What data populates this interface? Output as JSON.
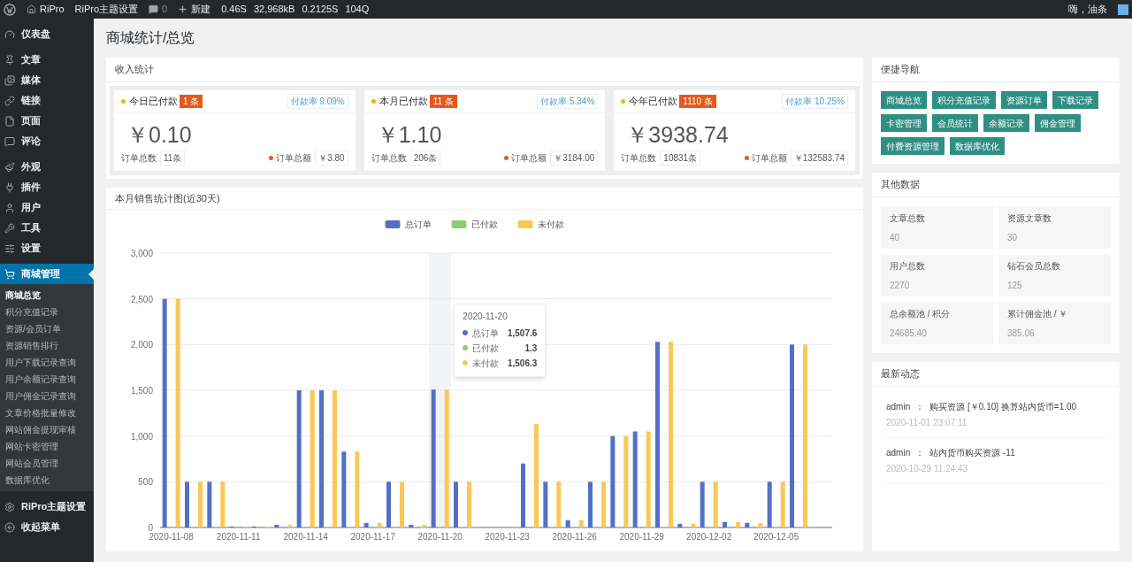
{
  "admin_bar": {
    "site": "RiPro",
    "theme_settings": "RiPro主题设置",
    "comments": "0",
    "new": "新建",
    "stats": [
      "0.46S",
      "32,968kB",
      "0.2125S",
      "104Q"
    ],
    "greeting": "嗨，油条"
  },
  "sidebar": {
    "groups": [
      [
        {
          "label": "仪表盘",
          "selected": false
        }
      ],
      [
        {
          "label": "文章",
          "selected": false
        },
        {
          "label": "媒体",
          "selected": false
        },
        {
          "label": "链接",
          "selected": false
        },
        {
          "label": "页面",
          "selected": false
        },
        {
          "label": "评论",
          "selected": false
        }
      ],
      [
        {
          "label": "外观",
          "selected": false
        },
        {
          "label": "插件",
          "selected": false
        },
        {
          "label": "用户",
          "selected": false
        },
        {
          "label": "工具",
          "selected": false
        },
        {
          "label": "设置",
          "selected": false
        }
      ],
      [
        {
          "label": "商城管理",
          "selected": true,
          "children": [
            {
              "label": "商城总览",
              "selected": true
            },
            {
              "label": "积分充值记录",
              "selected": false
            },
            {
              "label": "资源/会员订单",
              "selected": false
            },
            {
              "label": "资源销售排行",
              "selected": false
            },
            {
              "label": "用户下载记录查询",
              "selected": false
            },
            {
              "label": "用户余额记录查询",
              "selected": false
            },
            {
              "label": "用户佣金记录查询",
              "selected": false
            },
            {
              "label": "文章价格批量修改",
              "selected": false
            },
            {
              "label": "网站佣金提现审核",
              "selected": false
            },
            {
              "label": "网站卡密管理",
              "selected": false
            },
            {
              "label": "网站会员管理",
              "selected": false
            },
            {
              "label": "数据库优化",
              "selected": false
            }
          ]
        }
      ],
      [
        {
          "label": "RiPro主题设置",
          "selected": false
        },
        {
          "label": "收起菜单",
          "selected": false
        }
      ]
    ]
  },
  "page_title": "商城统计/总览",
  "income": {
    "title": "收入统计",
    "cards": [
      {
        "label": "今日已付款",
        "badge": "1 条",
        "rate": "付款率 9.09%",
        "amount": "￥0.10",
        "count_label": "订单总数",
        "count": "11条",
        "total_label": "订单总额",
        "total": "￥3.80"
      },
      {
        "label": "本月已付款",
        "badge": "11 条",
        "rate": "付款率 5.34%",
        "amount": "￥1.10",
        "count_label": "订单总数",
        "count": "206条",
        "total_label": "订单总额",
        "total": "￥3184.00"
      },
      {
        "label": "今年已付款",
        "badge": "1110 条",
        "rate": "付款率 10.25%",
        "amount": "￥3938.74",
        "count_label": "订单总数",
        "count": "10831条",
        "total_label": "订单总额",
        "total": "￥132583.74"
      }
    ]
  },
  "sales_chart": {
    "title": "本月销售统计图(近30天)",
    "chart_data": {
      "type": "bar",
      "legend": "top",
      "grid": true,
      "categories": [
        "2020-11-08",
        null,
        null,
        "2020-11-11",
        null,
        null,
        "2020-11-14",
        null,
        null,
        "2020-11-17",
        null,
        null,
        "2020-11-20",
        null,
        null,
        "2020-11-23",
        null,
        null,
        "2020-11-26",
        null,
        null,
        "2020-11-29",
        null,
        null,
        "2020-12-02",
        null,
        null,
        "2020-12-05",
        null,
        null
      ],
      "series": [
        {
          "name": "总订单",
          "color": "#5470c6",
          "values": [
            2500,
            500,
            500,
            10,
            10,
            30,
            1500,
            1500,
            830,
            50,
            500,
            30,
            1507.6,
            500,
            0,
            0,
            700,
            500,
            80,
            500,
            1000,
            1050,
            2030,
            40,
            500,
            60,
            50,
            500,
            2000,
            0
          ]
        },
        {
          "name": "已付款",
          "color": "#91cc75",
          "values": [
            0,
            0,
            0,
            1,
            1,
            1,
            0,
            0,
            0,
            1,
            0,
            1,
            1.3,
            0,
            0,
            0,
            1,
            0,
            1,
            0,
            0,
            1,
            0,
            1,
            0,
            1,
            1,
            0,
            0,
            0
          ]
        },
        {
          "name": "未付款",
          "color": "#fac858",
          "values": [
            2500,
            500,
            500,
            9,
            9,
            29,
            1500,
            1500,
            830,
            49,
            500,
            29,
            1506.3,
            500,
            0,
            0,
            1130,
            500,
            79,
            500,
            1000,
            1049,
            2030,
            39,
            500,
            59,
            49,
            500,
            2000,
            0
          ]
        }
      ],
      "ylim": [
        0,
        3000
      ],
      "yticks": [
        {
          "value": 0,
          "label": "0"
        },
        {
          "value": 500,
          "label": "500"
        },
        {
          "value": 1000,
          "label": "1,000"
        },
        {
          "value": 1500,
          "label": "1,500"
        },
        {
          "value": 2000,
          "label": "2,000"
        },
        {
          "value": 2500,
          "label": "2,500"
        },
        {
          "value": 3000,
          "label": "3,000"
        }
      ]
    },
    "tooltip": {
      "date": "2020-11-20",
      "rows": [
        {
          "name": "总订单",
          "value": "1,507.6",
          "color": "#5470c6"
        },
        {
          "name": "已付款",
          "value": "1.3",
          "color": "#91cc75"
        },
        {
          "name": "未付款",
          "value": "1,506.3",
          "color": "#fac858"
        }
      ]
    }
  },
  "quick_nav": {
    "title": "便捷导航",
    "links": [
      "商城总览",
      "积分充值记录",
      "资源订单",
      "下载记录",
      "卡密管理",
      "会员统计",
      "余额记录",
      "佣金管理",
      "付费资源管理",
      "数据库优化"
    ]
  },
  "other_data": {
    "title": "其他数据",
    "stats": [
      {
        "label": "文章总数",
        "value": "40"
      },
      {
        "label": "资源文章数",
        "value": "30"
      },
      {
        "label": "用户总数",
        "value": "2270"
      },
      {
        "label": "钻石会员总数",
        "value": "125"
      },
      {
        "label": "总余额池 / 积分",
        "value": "24685.40"
      },
      {
        "label": "累计佣金池 / ￥",
        "value": "385.06"
      }
    ]
  },
  "activity": {
    "title": "最新动态",
    "items": [
      {
        "user": "admin",
        "separator": "：",
        "text": "购买资源 [￥0.10] 换算站内货币=1.00",
        "time": "2020-11-01 23:07:11"
      },
      {
        "user": "admin",
        "separator": "：",
        "text": "站内货币购买资源 -11",
        "time": "2020-10-29 11:24:43"
      }
    ]
  }
}
